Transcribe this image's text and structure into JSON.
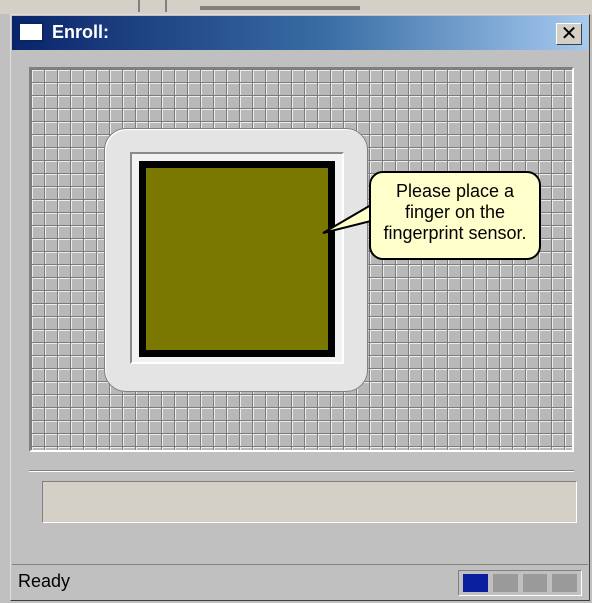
{
  "window": {
    "title": "Enroll:",
    "close_label": "✕"
  },
  "tooltip": {
    "lines": [
      "Please place a",
      "finger on the",
      "fingerprint sensor."
    ]
  },
  "message_box": {
    "text": ""
  },
  "status": {
    "text": "Ready",
    "progress_completed": 1,
    "progress_total": 4,
    "progress_color": "#0a1fa0"
  }
}
